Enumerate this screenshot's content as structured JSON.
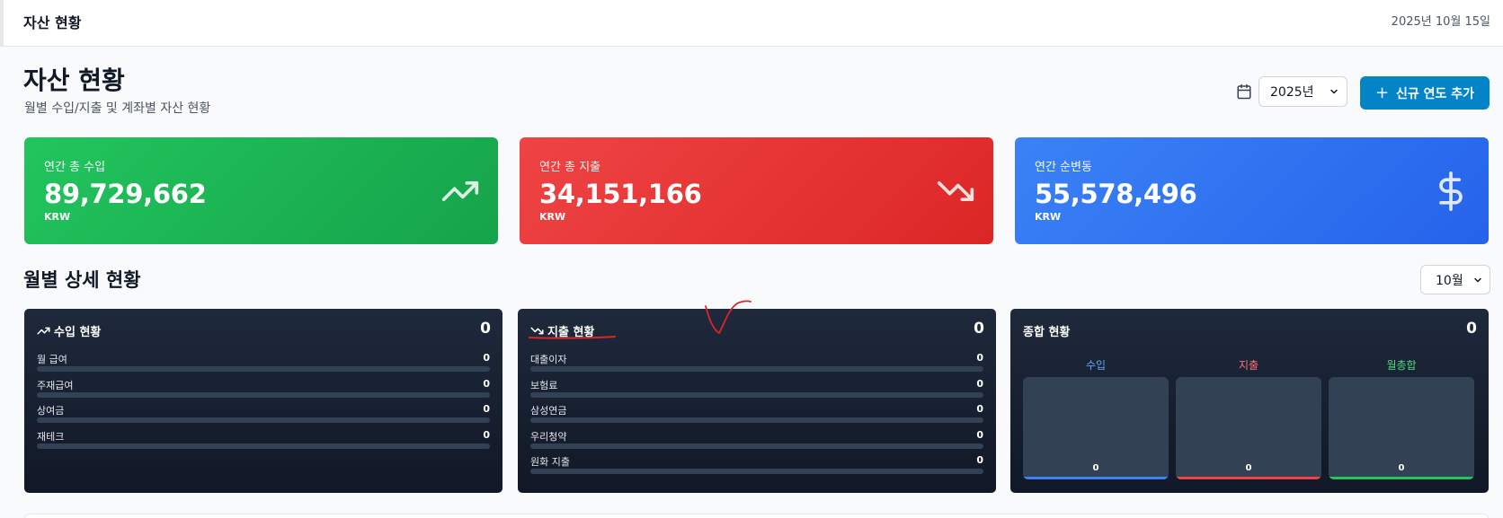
{
  "topbar": {
    "title": "자산 현황",
    "date": "2025년 10월 15일"
  },
  "header": {
    "title": "자산 현황",
    "subtitle": "월별 수입/지출 및 계좌별 자산 현황"
  },
  "controls": {
    "year_selected": "2025년",
    "add_year_label": "신규 연도 추가"
  },
  "stats": {
    "income": {
      "label": "연간 총 수입",
      "value": "89,729,662",
      "unit": "KRW",
      "icon": "trending-up-icon"
    },
    "expense": {
      "label": "연간 총 지출",
      "value": "34,151,166",
      "unit": "KRW",
      "icon": "trending-down-icon"
    },
    "net": {
      "label": "연간 순변동",
      "value": "55,578,496",
      "unit": "KRW",
      "icon": "dollar-icon"
    }
  },
  "monthly": {
    "title": "월별 상세 현황",
    "month_selected": "10월",
    "income_panel": {
      "title": "수입 현황",
      "total": "0",
      "items": [
        {
          "label": "월 급여",
          "amount": "0",
          "progress": 0
        },
        {
          "label": "주재급여",
          "amount": "0",
          "progress": 0
        },
        {
          "label": "상여금",
          "amount": "0",
          "progress": 0
        },
        {
          "label": "재테크",
          "amount": "0",
          "progress": 0
        }
      ]
    },
    "expense_panel": {
      "title": "지출 현황",
      "total": "0",
      "items": [
        {
          "label": "대출이자",
          "amount": "0",
          "progress": 0
        },
        {
          "label": "보험료",
          "amount": "0",
          "progress": 0
        },
        {
          "label": "삼성연금",
          "amount": "0",
          "progress": 0
        },
        {
          "label": "우리청약",
          "amount": "0",
          "progress": 0
        },
        {
          "label": "원화 지출",
          "amount": "0",
          "progress": 0
        }
      ]
    },
    "summary_panel": {
      "title": "종합 현황",
      "total": "0",
      "columns": [
        {
          "label": "수입",
          "value": "0",
          "color": "#60a5fa",
          "accent": "#3b82f6"
        },
        {
          "label": "지출",
          "value": "0",
          "color": "#f87171",
          "accent": "#ef4444"
        },
        {
          "label": "월총합",
          "value": "0",
          "color": "#4ade80",
          "accent": "#22c55e"
        }
      ]
    }
  },
  "colors": {
    "income": "#16a34a",
    "expense": "#dc2626",
    "net": "#2563eb",
    "primary_button": "#0284c7",
    "panel_dark": "#1e293b",
    "annotation": "#dc2626"
  }
}
